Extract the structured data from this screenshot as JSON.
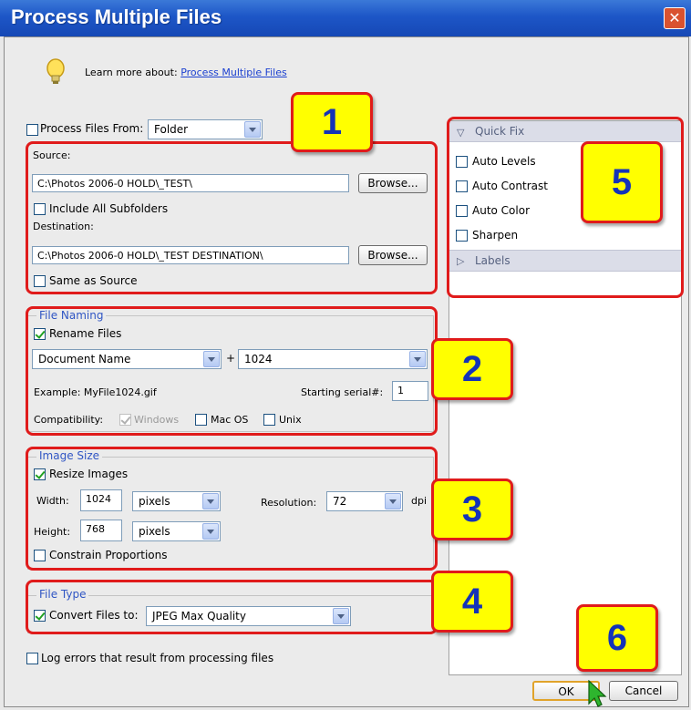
{
  "window": {
    "title": "Process Multiple Files",
    "close_label": "✕"
  },
  "learn_more": {
    "text": "Learn more about:",
    "link": "Process Multiple Files"
  },
  "process_from": {
    "label": "Process Files From:",
    "value": "Folder"
  },
  "source": {
    "label": "Source:",
    "path": "C:\\Photos 2006-0 HOLD\\_TEST\\",
    "browse_label": "Browse...",
    "include_subfolders_label": "Include All Subfolders"
  },
  "destination": {
    "label": "Destination:",
    "path": "C:\\Photos 2006-0 HOLD\\_TEST DESTINATION\\",
    "browse_label": "Browse...",
    "same_as_source_label": "Same as Source"
  },
  "file_naming": {
    "group_title": "File Naming",
    "rename_label": "Rename Files",
    "name_format": "Document Name",
    "plus": "+",
    "serial_format": "1024",
    "example": "Example: MyFile1024.gif",
    "starting_serial_label": "Starting serial#:",
    "starting_serial_value": "1",
    "compatibility_label": "Compatibility:",
    "windows_label": "Windows",
    "mac_label": "Mac OS",
    "unix_label": "Unix"
  },
  "image_size": {
    "group_title": "Image Size",
    "resize_label": "Resize Images",
    "width_label": "Width:",
    "width_value": "1024",
    "width_unit": "pixels",
    "height_label": "Height:",
    "height_value": "768",
    "height_unit": "pixels",
    "resolution_label": "Resolution:",
    "resolution_value": "72",
    "resolution_unit": "dpi",
    "constrain_label": "Constrain Proportions"
  },
  "file_type": {
    "group_title": "File Type",
    "convert_label": "Convert Files to:",
    "convert_value": "JPEG Max Quality"
  },
  "log_errors_label": "Log errors that result from processing files",
  "quick_fix": {
    "header": "Quick Fix",
    "items": [
      "Auto Levels",
      "Auto Contrast",
      "Auto Color",
      "Sharpen"
    ],
    "labels_header": "Labels"
  },
  "buttons": {
    "ok": "OK",
    "cancel": "Cancel"
  },
  "callouts": [
    "1",
    "2",
    "3",
    "4",
    "5",
    "6"
  ],
  "colors": {
    "title_bar": "#1d56c7",
    "callout_fill": "#ffff00",
    "callout_border": "#e01b1b",
    "callout_text": "#1433b8",
    "link": "#1a3fd0"
  }
}
